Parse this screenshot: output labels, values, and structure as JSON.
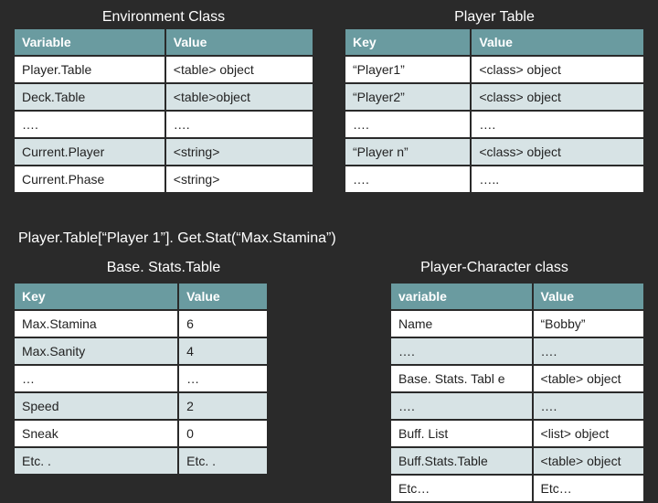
{
  "env": {
    "title": "Environment Class",
    "headers": [
      "Variable",
      "Value"
    ],
    "rows": [
      [
        "Player.Table",
        "<table> object"
      ],
      [
        "Deck.Table",
        "<table>object"
      ],
      [
        "….",
        "…."
      ],
      [
        "Current.Player",
        "<string>"
      ],
      [
        "Current.Phase",
        "<string>"
      ]
    ]
  },
  "player": {
    "title": "Player Table",
    "headers": [
      "Key",
      "Value"
    ],
    "rows": [
      [
        "“Player1”",
        "<class> object"
      ],
      [
        "“Player2”",
        "<class> object"
      ],
      [
        "….",
        "…."
      ],
      [
        "“Player n”",
        "<class> object"
      ],
      [
        "….",
        "….."
      ]
    ]
  },
  "code": "Player.Table[“Player 1”]. Get.Stat(“Max.Stamina”)",
  "base": {
    "title": "Base. Stats.Table",
    "headers": [
      "Key",
      "Value"
    ],
    "rows": [
      [
        "Max.Stamina",
        "6"
      ],
      [
        "Max.Sanity",
        "4"
      ],
      [
        "…",
        "…"
      ],
      [
        "Speed",
        "2"
      ],
      [
        "Sneak",
        "0"
      ],
      [
        "Etc. .",
        "Etc. ."
      ]
    ]
  },
  "pc": {
    "title": "Player-Character class",
    "headers": [
      "variable",
      "Value"
    ],
    "rows": [
      [
        "Name",
        "“Bobby”"
      ],
      [
        "….",
        "…."
      ],
      [
        "Base. Stats. Tabl e",
        "<table> object"
      ],
      [
        "….",
        "…."
      ],
      [
        "Buff. List",
        "<list> object"
      ],
      [
        "Buff.Stats.Table",
        "<table> object"
      ],
      [
        "Etc…",
        "Etc…"
      ]
    ]
  }
}
